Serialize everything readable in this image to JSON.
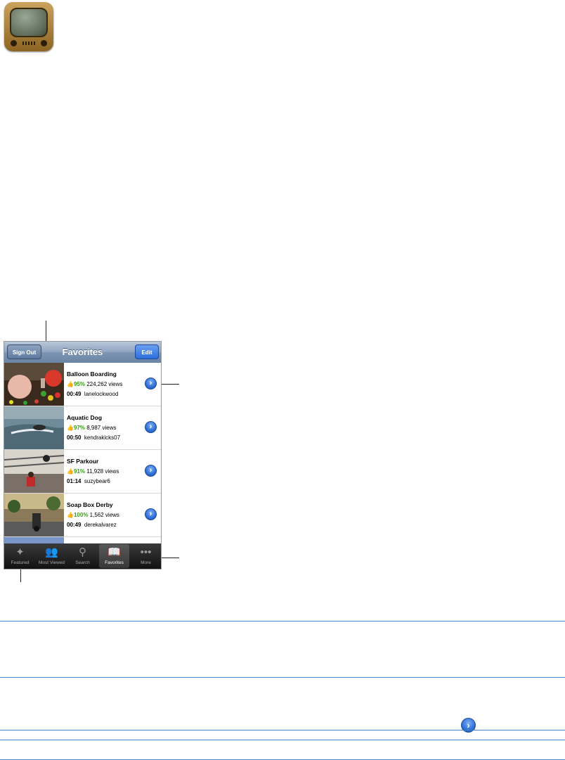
{
  "navbar": {
    "title": "Favorites",
    "sign_out_label": "Sign Out",
    "edit_label": "Edit"
  },
  "videos": [
    {
      "title": "Balloon Boarding",
      "rating": "95%",
      "views": "224,262 views",
      "duration": "00:49",
      "author": "lanelockwood"
    },
    {
      "title": "Aquatic Dog",
      "rating": "97%",
      "views": "8,987 views",
      "duration": "00:50",
      "author": "kendrakicks07"
    },
    {
      "title": "SF Parkour",
      "rating": "91%",
      "views": "11,928 views",
      "duration": "01:14",
      "author": "suzybear6"
    },
    {
      "title": "Soap Box Derby",
      "rating": "100%",
      "views": "1,562 views",
      "duration": "00:49",
      "author": "derekalvarez"
    }
  ],
  "tabs": [
    {
      "label": "Featured",
      "icon": "featured-icon"
    },
    {
      "label": "Most Viewed",
      "icon": "most-viewed-icon"
    },
    {
      "label": "Search",
      "icon": "search-icon"
    },
    {
      "label": "Favorites",
      "icon": "favorites-icon",
      "active": true
    },
    {
      "label": "More",
      "icon": "more-icon"
    }
  ],
  "colors": {
    "rating_green": "#3a9a1c",
    "rule_blue": "#4a86c7",
    "accent_blue": "#2e6fd6"
  }
}
